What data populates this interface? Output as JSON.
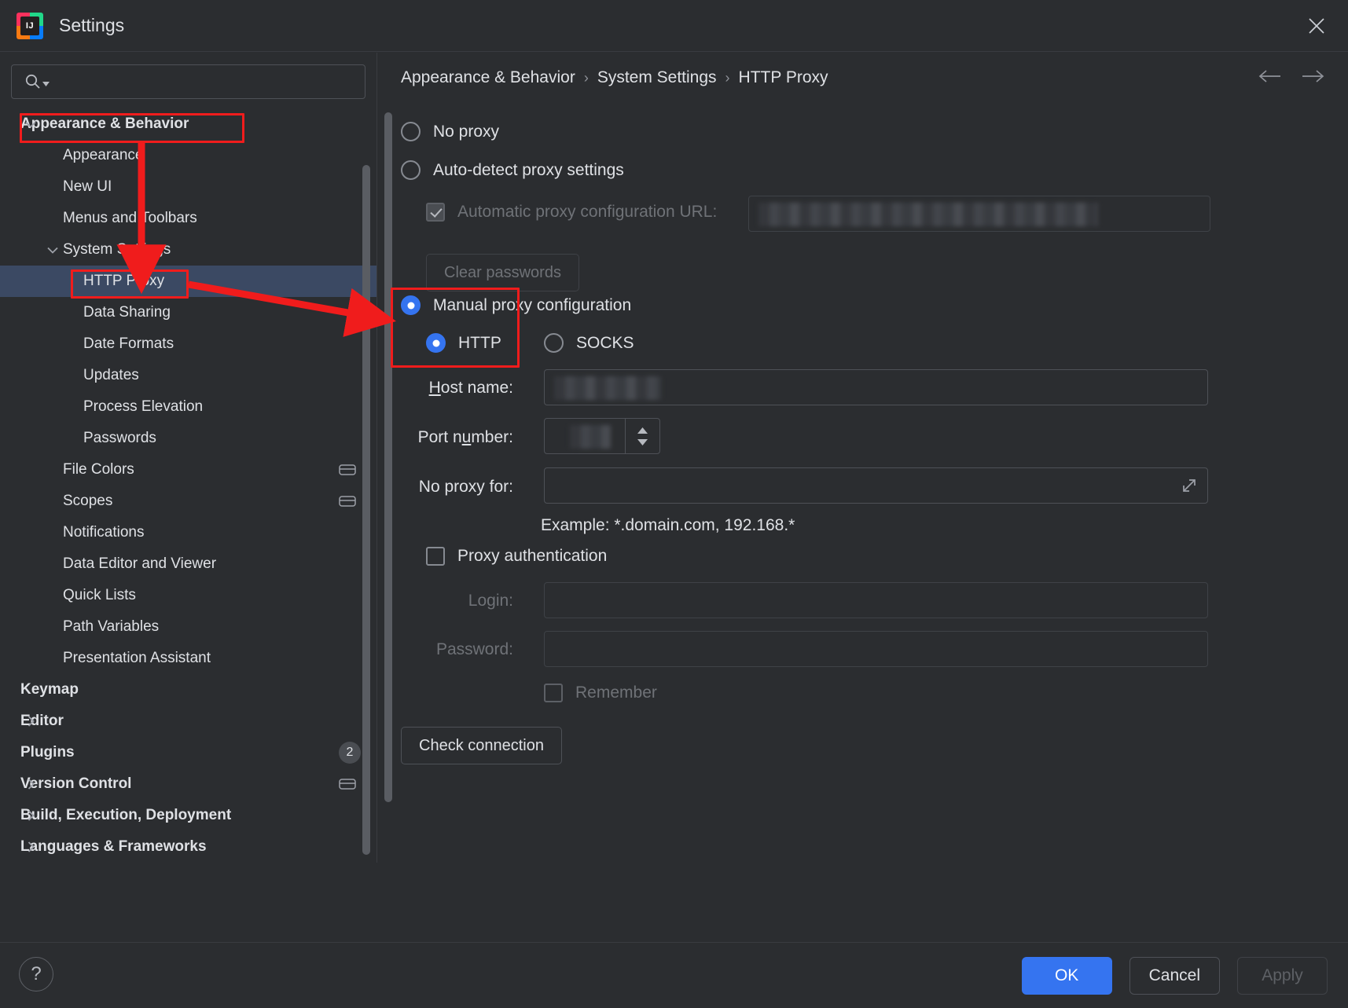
{
  "window": {
    "title": "Settings",
    "logo_text": "IJ",
    "close_icon": "close-icon"
  },
  "search": {
    "value": "",
    "placeholder": ""
  },
  "sidebar": {
    "items": [
      {
        "label": "Appearance & Behavior",
        "level": 0,
        "twisty": "expanded",
        "bold": true,
        "selected": false,
        "right_icon": "",
        "badge": ""
      },
      {
        "label": "Appearance",
        "level": 1,
        "twisty": "",
        "bold": false,
        "selected": false,
        "right_icon": "",
        "badge": ""
      },
      {
        "label": "New UI",
        "level": 1,
        "twisty": "",
        "bold": false,
        "selected": false,
        "right_icon": "",
        "badge": ""
      },
      {
        "label": "Menus and Toolbars",
        "level": 1,
        "twisty": "",
        "bold": false,
        "selected": false,
        "right_icon": "",
        "badge": ""
      },
      {
        "label": "System Settings",
        "level": 1,
        "twisty": "expanded",
        "bold": false,
        "selected": false,
        "right_icon": "",
        "badge": ""
      },
      {
        "label": "HTTP Proxy",
        "level": 2,
        "twisty": "",
        "bold": false,
        "selected": true,
        "right_icon": "",
        "badge": ""
      },
      {
        "label": "Data Sharing",
        "level": 2,
        "twisty": "",
        "bold": false,
        "selected": false,
        "right_icon": "",
        "badge": ""
      },
      {
        "label": "Date Formats",
        "level": 2,
        "twisty": "",
        "bold": false,
        "selected": false,
        "right_icon": "",
        "badge": ""
      },
      {
        "label": "Updates",
        "level": 2,
        "twisty": "",
        "bold": false,
        "selected": false,
        "right_icon": "",
        "badge": ""
      },
      {
        "label": "Process Elevation",
        "level": 2,
        "twisty": "",
        "bold": false,
        "selected": false,
        "right_icon": "",
        "badge": ""
      },
      {
        "label": "Passwords",
        "level": 2,
        "twisty": "",
        "bold": false,
        "selected": false,
        "right_icon": "",
        "badge": ""
      },
      {
        "label": "File Colors",
        "level": 1,
        "twisty": "",
        "bold": false,
        "selected": false,
        "right_icon": "project-scope-icon",
        "badge": ""
      },
      {
        "label": "Scopes",
        "level": 1,
        "twisty": "",
        "bold": false,
        "selected": false,
        "right_icon": "project-scope-icon",
        "badge": ""
      },
      {
        "label": "Notifications",
        "level": 1,
        "twisty": "",
        "bold": false,
        "selected": false,
        "right_icon": "",
        "badge": ""
      },
      {
        "label": "Data Editor and Viewer",
        "level": 1,
        "twisty": "",
        "bold": false,
        "selected": false,
        "right_icon": "",
        "badge": ""
      },
      {
        "label": "Quick Lists",
        "level": 1,
        "twisty": "",
        "bold": false,
        "selected": false,
        "right_icon": "",
        "badge": ""
      },
      {
        "label": "Path Variables",
        "level": 1,
        "twisty": "",
        "bold": false,
        "selected": false,
        "right_icon": "",
        "badge": ""
      },
      {
        "label": "Presentation Assistant",
        "level": 1,
        "twisty": "",
        "bold": false,
        "selected": false,
        "right_icon": "",
        "badge": ""
      },
      {
        "label": "Keymap",
        "level": 0,
        "twisty": "",
        "bold": true,
        "selected": false,
        "right_icon": "",
        "badge": ""
      },
      {
        "label": "Editor",
        "level": 0,
        "twisty": "collapsed",
        "bold": true,
        "selected": false,
        "right_icon": "",
        "badge": ""
      },
      {
        "label": "Plugins",
        "level": 0,
        "twisty": "",
        "bold": true,
        "selected": false,
        "right_icon": "",
        "badge": "2"
      },
      {
        "label": "Version Control",
        "level": 0,
        "twisty": "collapsed",
        "bold": true,
        "selected": false,
        "right_icon": "project-scope-icon",
        "badge": ""
      },
      {
        "label": "Build, Execution, Deployment",
        "level": 0,
        "twisty": "collapsed",
        "bold": true,
        "selected": false,
        "right_icon": "",
        "badge": ""
      },
      {
        "label": "Languages & Frameworks",
        "level": 0,
        "twisty": "collapsed",
        "bold": true,
        "selected": false,
        "right_icon": "",
        "badge": ""
      }
    ]
  },
  "main": {
    "breadcrumb": [
      "Appearance & Behavior",
      "System Settings",
      "HTTP Proxy"
    ],
    "breadcrumb_separator": "›",
    "nav_back_icon": "arrow-left-icon",
    "nav_forward_icon": "arrow-right-icon",
    "no_proxy_label": "No proxy",
    "auto_detect_label": "Auto-detect proxy settings",
    "auto_config_url_label": "Automatic proxy configuration URL:",
    "auto_config_url_value": "",
    "clear_passwords_label": "Clear passwords",
    "manual_proxy_label": "Manual proxy configuration",
    "http_label": "HTTP",
    "socks_label": "SOCKS",
    "host_name_label": "Host name:",
    "host_name_value": "",
    "port_number_label": "Port number:",
    "port_number_value": "",
    "port_spinner_icon": "spinner-up-down-icon",
    "no_proxy_for_label": "No proxy for:",
    "no_proxy_for_value": "",
    "expand_icon": "expand-diagonal-icon",
    "example_text": "Example: *.domain.com, 192.168.*",
    "proxy_auth_label": "Proxy authentication",
    "login_label": "Login:",
    "login_value": "",
    "password_label": "Password:",
    "password_value": "",
    "remember_label": "Remember",
    "check_connection_label": "Check connection",
    "selected_proxy_mode": "manual",
    "selected_protocol": "http"
  },
  "footer": {
    "help_label": "?",
    "ok_label": "OK",
    "cancel_label": "Cancel",
    "apply_label": "Apply"
  },
  "colors": {
    "accent": "#3574f0",
    "selection": "#3b4963",
    "annotation": "#f01c1c",
    "background": "#2b2d30",
    "text": "#dfe1e5"
  }
}
